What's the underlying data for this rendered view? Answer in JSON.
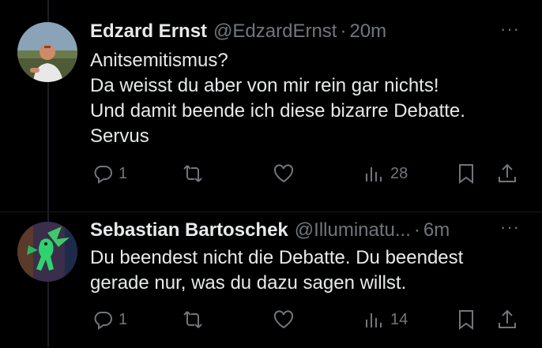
{
  "tweets": [
    {
      "author_name": "Edzard Ernst",
      "handle": "@EdzardErnst",
      "separator": "·",
      "time": "20m",
      "more": "···",
      "lines": [
        "Anitsemitismus?",
        "Da weisst du aber von mir rein gar nichts!",
        "Und damit beende ich diese bizarre Debatte.",
        "Servus"
      ],
      "reply_count": "1",
      "retweet_count": "",
      "like_count": "",
      "views_count": "28",
      "avatar_icon": "person-photo"
    },
    {
      "author_name": "Sebastian Bartoschek",
      "handle": "@Illuminatu...",
      "separator": "·",
      "time": "6m",
      "more": "···",
      "lines": [
        "Du beendest nicht die Debatte. Du beendest",
        "gerade nur, was du dazu sagen willst."
      ],
      "reply_count": "1",
      "retweet_count": "",
      "like_count": "",
      "views_count": "14",
      "avatar_icon": "dragon-illustration"
    }
  ],
  "colors": {
    "background": "#000000",
    "text": "#e7e9ea",
    "muted": "#71767b"
  }
}
